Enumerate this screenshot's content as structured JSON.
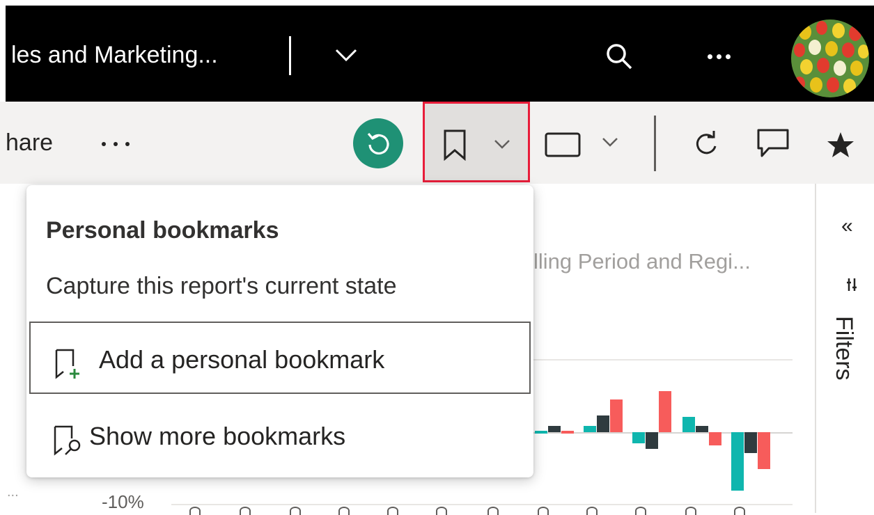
{
  "header": {
    "report_title": "les and Marketing...",
    "icons": [
      "chevron-down-icon",
      "search-icon",
      "more-icon",
      "avatar"
    ]
  },
  "actionbar": {
    "share_label": "hare",
    "buttons": [
      "more-icon",
      "reset-icon",
      "bookmark-icon",
      "view-icon",
      "refresh-icon",
      "comment-icon",
      "star-icon"
    ],
    "reset_color": "#1f9175",
    "highlight_color": "#e81d3a"
  },
  "dropdown": {
    "heading": "Personal bookmarks",
    "caption": "Capture this report's current state",
    "items": [
      {
        "label": "Add a personal bookmark",
        "icon": "bookmark-add-icon"
      },
      {
        "label": "Show more bookmarks",
        "icon": "bookmark-search-icon"
      }
    ]
  },
  "visual": {
    "title_fragment": "lling Period and Regi...",
    "axis_label": "-10%",
    "overflow": "...",
    "colors": {
      "teal": "#0fb6ae",
      "dark": "#2f3b3f",
      "red": "#f75c5b"
    }
  },
  "filters": {
    "label": "Filters",
    "collapse_glyph": "«"
  }
}
